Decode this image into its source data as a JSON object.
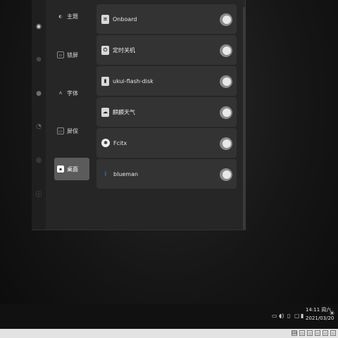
{
  "nav_items": [
    {
      "label": "主题",
      "icon": "theme-icon"
    },
    {
      "label": "锁屏",
      "icon": "lockscreen-icon"
    },
    {
      "label": "字体",
      "icon": "font-icon"
    },
    {
      "label": "屏保",
      "icon": "screensaver-icon"
    },
    {
      "label": "桌面",
      "icon": "desktop-icon",
      "selected": true
    }
  ],
  "startup_apps": [
    {
      "label": "Onboard",
      "icon": "onboard-icon",
      "enabled": true
    },
    {
      "label": "定时关机",
      "icon": "timer-shutdown-icon",
      "enabled": true
    },
    {
      "label": "ukui-flash-disk",
      "icon": "flash-disk-icon",
      "enabled": true
    },
    {
      "label": "麒麟天气",
      "icon": "weather-icon",
      "enabled": true
    },
    {
      "label": "Fcitx",
      "icon": "fcitx-icon",
      "enabled": true
    },
    {
      "label": "blueman",
      "icon": "bluetooth-icon",
      "enabled": true
    }
  ],
  "taskbar": {
    "time": "14:11",
    "weekday": "周六",
    "date": "2021/03/20"
  },
  "colors": {
    "window_bg": "#262626",
    "card_bg": "#333333",
    "selected_bg": "#5b5b5b",
    "toggle_on": "#8a8a8a"
  }
}
